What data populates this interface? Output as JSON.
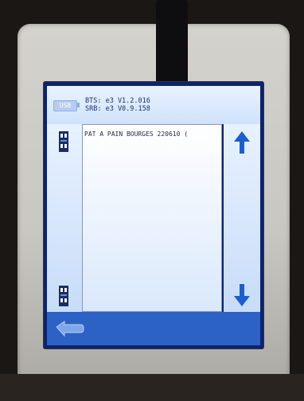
{
  "device": {
    "header": {
      "usb_label": "USB",
      "bts_line": "BTS: e3 V1.2.016",
      "srb_line": "SRB: e3 V0.9.158"
    },
    "list": {
      "items": [
        {
          "label": "PAT A PAIN BOURGES 220610 ("
        }
      ]
    },
    "icons": {
      "scroll_up": "arrow-up-icon",
      "scroll_down": "arrow-down-icon",
      "back": "back-arrow-icon",
      "pattern_top": "pattern-block-icon",
      "pattern_bottom": "pattern-block-icon"
    },
    "colors": {
      "screen_frame": "#0d2270",
      "panel_light": "#e8f2ff",
      "arrow_blue": "#1a5fd0",
      "footer": "#2c62c4"
    }
  }
}
